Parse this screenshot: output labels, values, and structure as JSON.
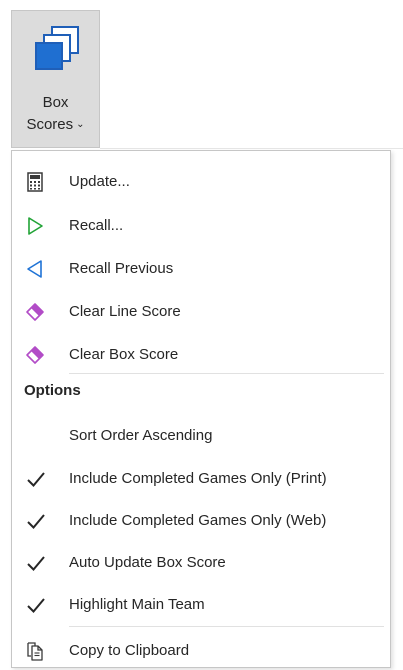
{
  "ribbon": {
    "button_line1": "Box",
    "button_line2": "Scores",
    "button_icon": "box-scores-icon"
  },
  "menu": {
    "items": [
      {
        "label": "Update...",
        "icon": "calculator-icon"
      },
      {
        "label": "Recall...",
        "icon": "play-outline-icon",
        "color": "#21a336"
      },
      {
        "label": "Recall Previous",
        "icon": "back-outline-icon",
        "color": "#1f73d6"
      },
      {
        "label": "Clear Line Score",
        "icon": "eraser-icon",
        "color": "#b24cc7"
      },
      {
        "label": "Clear Box Score",
        "icon": "eraser-icon",
        "color": "#b24cc7"
      }
    ],
    "options_header": "Options",
    "options": [
      {
        "label": "Sort Order Ascending",
        "checked": false
      },
      {
        "label": "Include Completed Games Only (Print)",
        "checked": true
      },
      {
        "label": "Include Completed Games Only (Web)",
        "checked": true
      },
      {
        "label": "Auto Update Box Score",
        "checked": true
      },
      {
        "label": "Highlight Main Team",
        "checked": true
      }
    ],
    "copy_label": "Copy to Clipboard",
    "copy_icon": "copy-clipboard-icon"
  },
  "colors": {
    "accent_blue": "#1f6fd1",
    "recall_green": "#21a336",
    "recall_prev_blue": "#1f73d6",
    "eraser_purple": "#b24cc7"
  }
}
